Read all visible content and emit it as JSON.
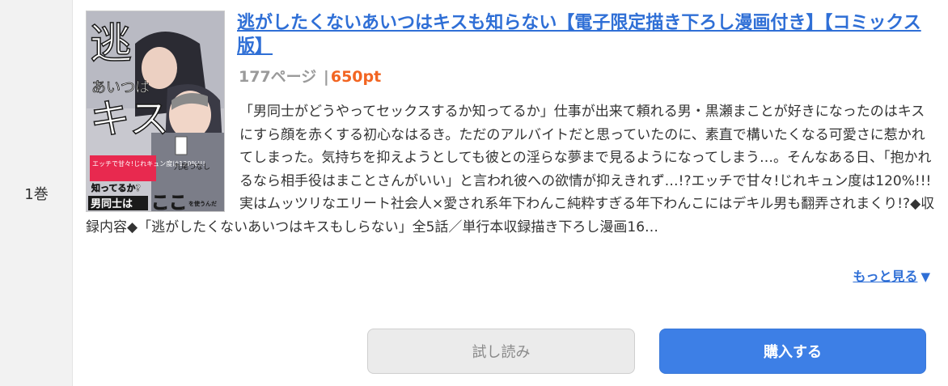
{
  "volume": {
    "label": "1巻"
  },
  "book": {
    "title": "逃がしたくないあいつはキスも知らない【電子限定描き下ろし漫画付き】【コミックス版】",
    "pages": "177ページ",
    "separator": "|",
    "price": "650pt",
    "description": "「男同士がどうやってセックスするか知ってるか」仕事が出来て頼れる男・黒瀬まことが好きになったのはキスにすら顔を赤くする初心なはるき。ただのアルバイトだと思っていたのに、素直で構いたくなる可愛さに惹かれてしまった。気持ちを抑えようとしても彼との淫らな夢まで見るようになってしまう…。そんなある日、「抱かれるなら相手役はまことさんがいい」と言われ彼への欲情が抑えきれず…!?エッチで甘々!じれキュン度は120%!!!実はムッツリなエリート社会人×愛され系年下わんこ純粋すぎる年下わんこにはデキル男も翻弄されまくり!?◆収録内容◆「逃がしたくないあいつはキスもしらない」全5話／単行本収録描き下ろし漫画16…"
  },
  "cover": {
    "title_text": "逃がしたくないあいつはキスも",
    "tagline": "エッチで甘々!じれキュン度は120%!!!",
    "author": "九尾つなし",
    "catch1": "知ってるか?",
    "catch2": "男同士は",
    "catch3": "ここ",
    "catch4": "を使うんだ",
    "colors": {
      "bg": "#c9c9cf",
      "accent": "#e8294f",
      "ink": "#1a1a1a"
    }
  },
  "actions": {
    "more_label": "もっと見る",
    "more_icon": "triangle-down-icon",
    "trial_label": "試し読み",
    "buy_label": "購入する"
  },
  "colors": {
    "link": "#2f6fd6",
    "price": "#f26522",
    "buy_bg": "#3d7fe6",
    "trial_bg": "#ebebeb"
  }
}
